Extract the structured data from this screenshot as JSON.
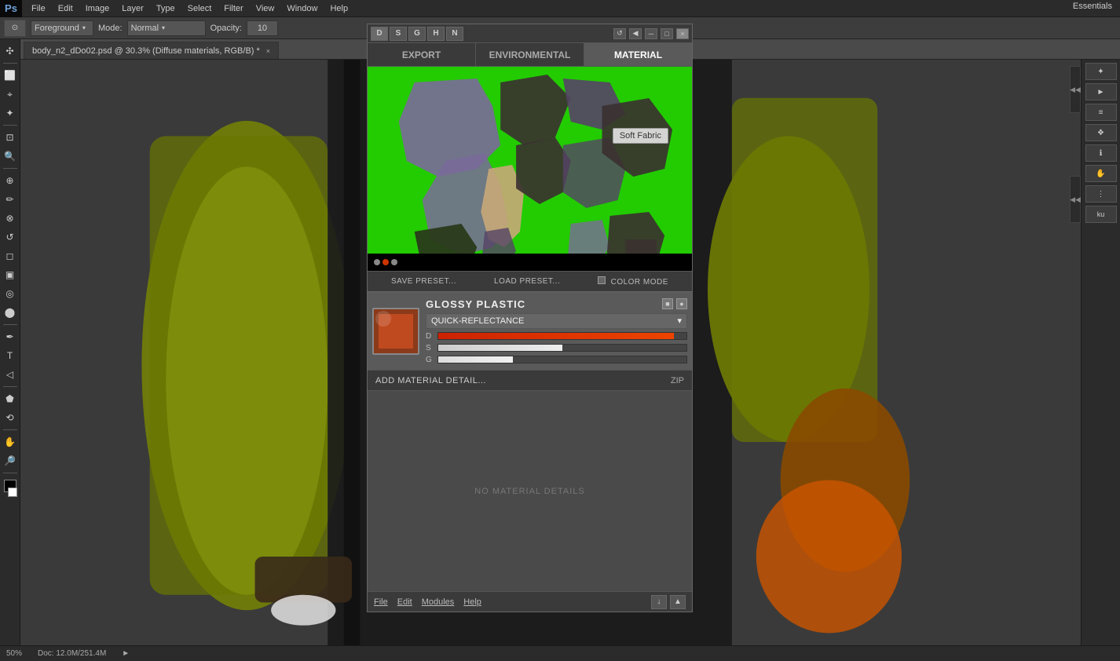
{
  "app": {
    "title": "Photoshop",
    "ps_label": "Ps",
    "essentials": "Essentials"
  },
  "top_menu": {
    "items": [
      "File",
      "Edit",
      "Image",
      "Layer",
      "Type",
      "Select",
      "Filter",
      "View",
      "Window",
      "Help"
    ]
  },
  "options_bar": {
    "tool_icon": "⊙",
    "foreground_label": "Foreground",
    "foreground_arrow": "▾",
    "mode_label": "Mode:",
    "mode_value": "Normal",
    "mode_arrow": "▾",
    "opacity_label": "Opacity:",
    "opacity_value": "10"
  },
  "tab": {
    "filename": "body_n2_dDo02.psd @ 30.3% (Diffuse materials, RGB/B) *",
    "close": "×"
  },
  "status_bar": {
    "zoom": "50%",
    "doc_info": "Doc: 12.0M/251.4M",
    "arrow": "►"
  },
  "ddo_panel": {
    "title_icons": [
      "D",
      "S",
      "G",
      "H",
      "N"
    ],
    "win_buttons": [
      "↺",
      "◀",
      "─",
      "□",
      "×"
    ],
    "tabs": [
      "EXPORT",
      "ENVIRONMENTAL",
      "MATERIAL"
    ],
    "active_tab": "MATERIAL",
    "preview": {
      "dots": [
        {
          "color": "#888888"
        },
        {
          "color": "#cc3300"
        },
        {
          "color": "#888888"
        }
      ],
      "tooltip": "Soft Fabric"
    },
    "preset_bar": {
      "save": "SAVE PRESET...",
      "load": "LOAD PRESET...",
      "color_mode": "COLOR MODE"
    },
    "material_card": {
      "title": "GLOSSY PLASTIC",
      "icon1": "■",
      "icon2": "●",
      "dropdown_label": "QUICK-REFLECTANCE",
      "dropdown_arrow": "▾",
      "sliders": [
        {
          "label": "D",
          "fill_class": "mat-slider-d",
          "width": "95%"
        },
        {
          "label": "S",
          "fill_class": "mat-slider-s",
          "width": "50%"
        },
        {
          "label": "G",
          "fill_class": "mat-slider-g",
          "width": "30%"
        }
      ]
    },
    "add_detail_label": "ADD MATERIAL DETAIL...",
    "zip_label": "ZIP",
    "no_details_text": "NO MATERIAL DETAILS",
    "bottom_menu": {
      "file": "File",
      "edit": "Edit",
      "modules": "Modules",
      "help": "Help"
    },
    "bottom_btns": [
      "↓",
      "▲"
    ]
  },
  "right_panel": {
    "icons": [
      "✦",
      "►",
      "≡",
      "❖",
      "ℹ",
      "✋",
      "⋮",
      "ku"
    ]
  }
}
